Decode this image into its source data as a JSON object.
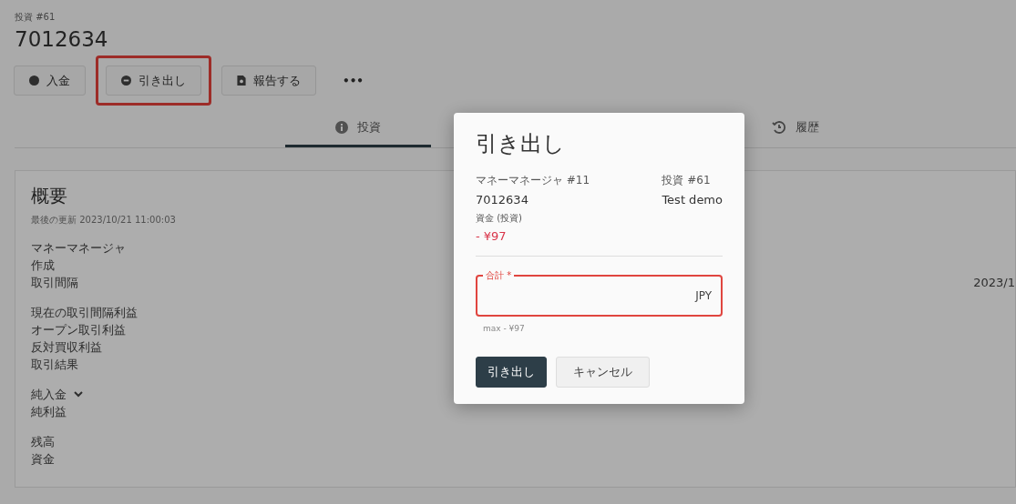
{
  "page": {
    "breadcrumb": "投資 #61",
    "title": "7012634"
  },
  "actions": [
    {
      "label": "入金",
      "highlighted": false
    },
    {
      "label": "引き出し",
      "highlighted": true
    },
    {
      "label": "報告する",
      "highlighted": false
    }
  ],
  "more_button": "•••",
  "tabs": [
    {
      "label": "投資",
      "selected": true
    },
    {
      "label": "履歴",
      "selected": false
    }
  ],
  "overview": {
    "title": "概要",
    "updated": "最後の更新 2023/10/21 11:00:03",
    "groups": [
      {
        "rows": [
          {
            "label": "マネーマネージャ",
            "kind": "plain"
          },
          {
            "label": "作成",
            "kind": "plain"
          },
          {
            "label": "取引間隔",
            "kind": "plain",
            "value": "2023/1"
          }
        ]
      },
      {
        "rows": [
          {
            "label": "現在の取引間隔利益",
            "kind": "plain"
          },
          {
            "label": "オープン取引利益",
            "kind": "plain"
          },
          {
            "label": "反対買収利益",
            "kind": "plain"
          },
          {
            "label": "取引結果",
            "kind": "plain"
          }
        ]
      },
      {
        "rows": [
          {
            "label": "純入金",
            "kind": "toggle"
          },
          {
            "label": "純利益",
            "kind": "plain"
          }
        ]
      },
      {
        "rows": [
          {
            "label": "残高",
            "kind": "plain"
          },
          {
            "label": "資金",
            "kind": "plain"
          }
        ]
      }
    ]
  },
  "dialog": {
    "title": "引き出し",
    "info": [
      {
        "label": "マネーマネージャ #11",
        "value": "7012634"
      },
      {
        "label": "投資 #61",
        "value": "Test demo"
      }
    ],
    "funds": {
      "label": "資金 (投資)",
      "value": "- ¥97"
    },
    "field": {
      "label": "合計 *",
      "suffix": "JPY",
      "hint": "max - ¥97",
      "error": true
    },
    "buttons": [
      {
        "label": "引き出し",
        "kind": "primary"
      },
      {
        "label": "キャンセル",
        "kind": "secondary"
      }
    ]
  }
}
